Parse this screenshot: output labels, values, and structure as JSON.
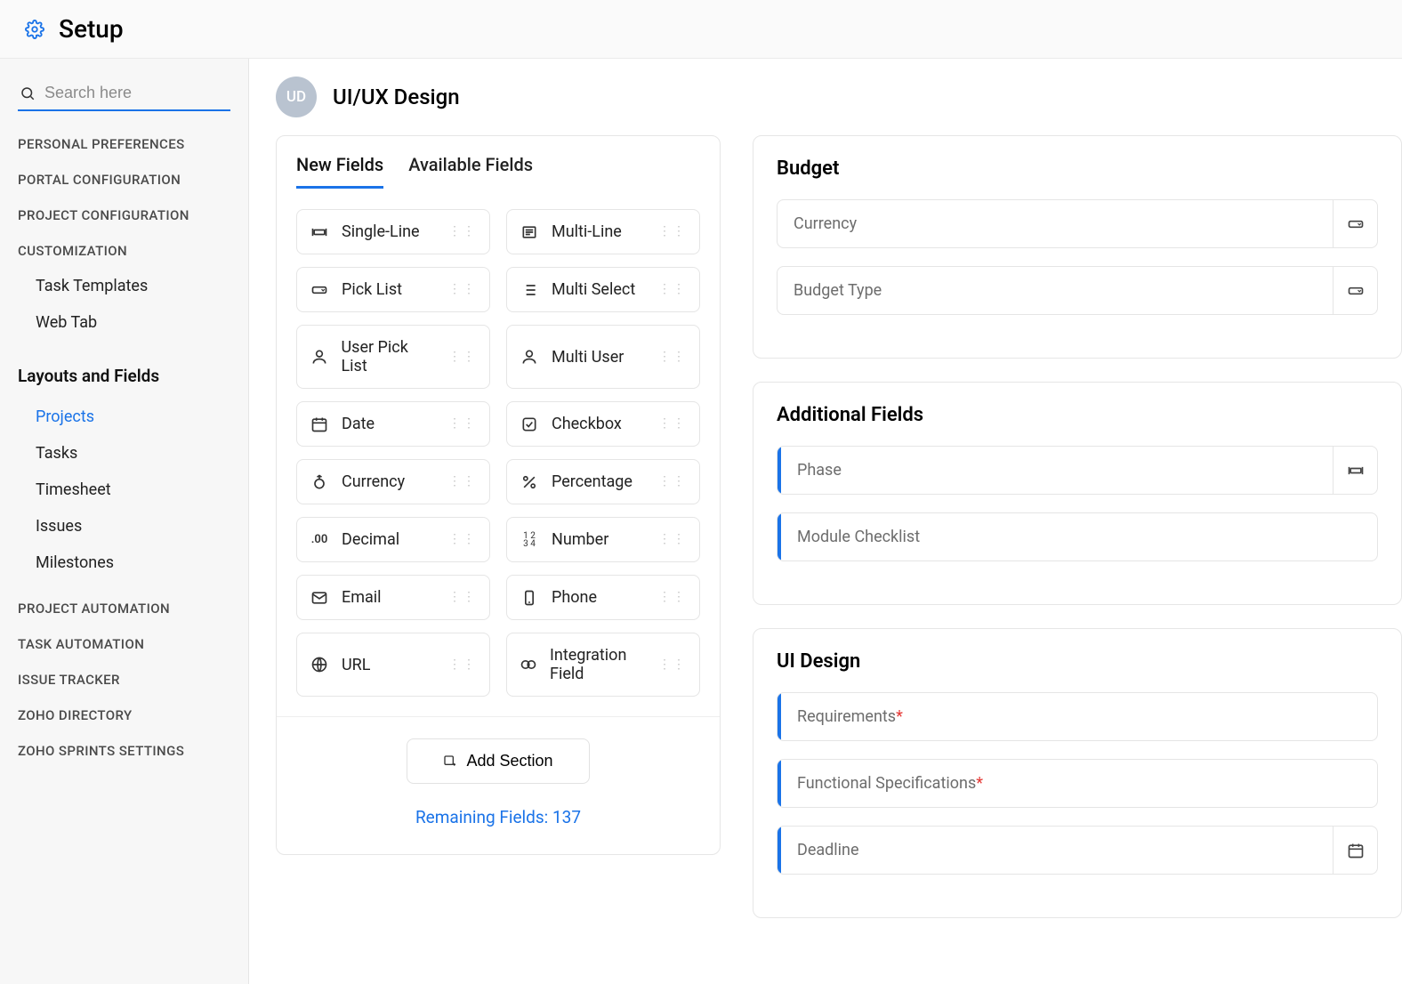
{
  "topbar": {
    "title": "Setup"
  },
  "search": {
    "placeholder": "Search here"
  },
  "sidebar": {
    "groups": [
      "PERSONAL PREFERENCES",
      "PORTAL CONFIGURATION",
      "PROJECT CONFIGURATION",
      "CUSTOMIZATION"
    ],
    "customization_items": [
      "Task Templates",
      "Web Tab"
    ],
    "layouts_heading": "Layouts and Fields",
    "layouts_items": [
      "Projects",
      "Tasks",
      "Timesheet",
      "Issues",
      "Milestones"
    ],
    "tail_groups": [
      "PROJECT AUTOMATION",
      "TASK AUTOMATION",
      "ISSUE TRACKER",
      "ZOHO DIRECTORY",
      "ZOHO SPRINTS SETTINGS"
    ]
  },
  "page": {
    "avatar_initials": "UD",
    "title": "UI/UX Design"
  },
  "fieldTabs": {
    "new": "New Fields",
    "available": "Available Fields"
  },
  "newFields": [
    {
      "label": "Single-Line",
      "icon": "singleline"
    },
    {
      "label": "Multi-Line",
      "icon": "multiline"
    },
    {
      "label": "Pick List",
      "icon": "picklist"
    },
    {
      "label": "Multi Select",
      "icon": "multiselect"
    },
    {
      "label": "User Pick List",
      "icon": "user"
    },
    {
      "label": "Multi User",
      "icon": "user"
    },
    {
      "label": "Date",
      "icon": "date"
    },
    {
      "label": "Checkbox",
      "icon": "checkbox"
    },
    {
      "label": "Currency",
      "icon": "currency"
    },
    {
      "label": "Percentage",
      "icon": "percent"
    },
    {
      "label": "Decimal",
      "icon": "decimal"
    },
    {
      "label": "Number",
      "icon": "number"
    },
    {
      "label": "Email",
      "icon": "email"
    },
    {
      "label": "Phone",
      "icon": "phone"
    },
    {
      "label": "URL",
      "icon": "url"
    },
    {
      "label": "Integration Field",
      "icon": "integration"
    }
  ],
  "addSection": {
    "label": "Add Section"
  },
  "remaining": {
    "text": "Remaining Fields: 137"
  },
  "sections": [
    {
      "title": "Budget",
      "fields": [
        {
          "label": "Currency",
          "accent": false,
          "icon": "picklist",
          "required": false
        },
        {
          "label": "Budget Type",
          "accent": false,
          "icon": "picklist",
          "required": false
        }
      ]
    },
    {
      "title": "Additional Fields",
      "fields": [
        {
          "label": "Phase",
          "accent": true,
          "icon": "singleline",
          "required": false
        },
        {
          "label": "Module Checklist",
          "accent": true,
          "icon": "",
          "required": false
        }
      ]
    },
    {
      "title": "UI Design",
      "fields": [
        {
          "label": "Requirements",
          "accent": true,
          "icon": "",
          "required": true
        },
        {
          "label": "Functional Specifications",
          "accent": true,
          "icon": "",
          "required": true
        },
        {
          "label": "Deadline",
          "accent": true,
          "icon": "date",
          "required": false
        }
      ]
    }
  ]
}
